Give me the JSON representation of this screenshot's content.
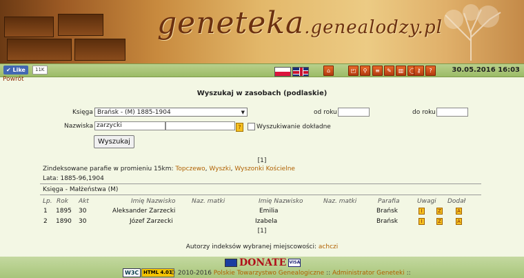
{
  "banner": {
    "title": "geneteka",
    "title_suffix": ".genealodzy.pl"
  },
  "toolbar": {
    "like_label": "✔ Like",
    "like_count": "11K",
    "datetime": "30.05.2016 16:03"
  },
  "back_link": "Powrót",
  "heading": "Wyszukaj w zasobach (podlaskie)",
  "form": {
    "ksiega_label": "Księga",
    "ksiega_value": "Brańsk - (M) 1885-1904",
    "od_roku_label": "od roku",
    "do_roku_label": "do roku",
    "nazwiska_label": "Nazwiska",
    "nazwiska_value": "zarzycki",
    "help_icon": "?",
    "exact_label": "Wyszukiwanie dokładne",
    "search_button": "Wyszukaj"
  },
  "pagination": "[1]",
  "parishes": {
    "prefix": "Zindeksowane parafie w promieniu 15km:",
    "items": [
      "Topczewo",
      "Wyszki",
      "Wyszonki Kościelne"
    ],
    "sep": ", "
  },
  "years": "Lata: 1885-96,1904",
  "book": "Księga - Małżeństwa (M)",
  "table": {
    "headers": [
      "Lp.",
      "Rok",
      "Akt",
      "Imię Nazwisko",
      "Naz. matki",
      "Imię Nazwisko",
      "Naz. matki",
      "Parafia",
      "Uwagi",
      "Dodał"
    ],
    "rows": [
      {
        "lp": "1",
        "rok": "1895",
        "akt": "30",
        "groom": "Aleksander Zarzecki",
        "bride": "Emilia",
        "parafia": "Brańsk",
        "u1": "I",
        "u2": "Z",
        "d": "A"
      },
      {
        "lp": "2",
        "rok": "1890",
        "akt": "30",
        "groom": "Józef Zarzecki",
        "bride": "Izabela",
        "parafia": "Brańsk",
        "u1": "I",
        "u2": "Z",
        "d": "A"
      }
    ]
  },
  "authors": {
    "prefix": "Autorzy indeksów wybranej miejscowości:",
    "name": "achczi"
  },
  "footer": {
    "donate": "DONATE",
    "visa": "VISA",
    "w3c": "W3C",
    "html": "HTML 4.01",
    "copyright": "© 2010-2016",
    "org_link": "Polskie Towarzystwo Genealogiczne",
    "sep": " :: ",
    "admin_link": "Administrator Geneteki",
    "end": " ::"
  },
  "colors": {
    "link": "#b06000",
    "accent": "#8b2a00",
    "header_green": "#b9d08c"
  }
}
